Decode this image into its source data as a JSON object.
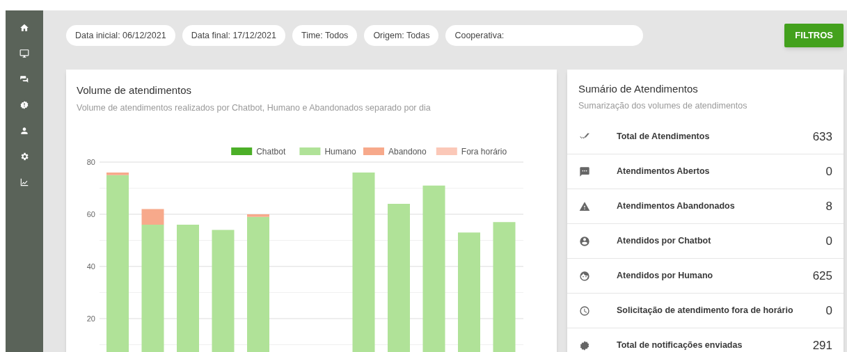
{
  "filters": [
    {
      "kind": "chip",
      "label": "Data inicial: 06/12/2021"
    },
    {
      "kind": "chip",
      "label": "Data final: 17/12/2021"
    },
    {
      "kind": "chip",
      "label": "Time: Todos"
    },
    {
      "kind": "chip",
      "label": "Origem: Todas"
    },
    {
      "kind": "field",
      "label": "Cooperativa:"
    }
  ],
  "filter_button": "FILTROS",
  "volume_card": {
    "title": "Volume de atendimentos",
    "subtitle": "Volume de atendimentos realizados por Chatbot, Humano e Abandonados separado por dia",
    "chart_data": {
      "type": "bar",
      "stacked": true,
      "grid": true,
      "legend": true,
      "ylim": [
        0,
        80
      ],
      "yticks": [
        20,
        40,
        60,
        80
      ],
      "series": [
        {
          "name": "Chatbot",
          "color": "#4caf28",
          "values": [
            0,
            0,
            0,
            0,
            0,
            0,
            0,
            0,
            0,
            0,
            0,
            0
          ]
        },
        {
          "name": "Humano",
          "color": "#b0e298",
          "values": [
            75,
            56,
            56,
            54,
            59,
            0,
            0,
            76,
            64,
            71,
            53,
            57
          ]
        },
        {
          "name": "Abandono",
          "color": "#f7a98b",
          "values": [
            1,
            6,
            0,
            0,
            1,
            0,
            0,
            0,
            0,
            0,
            0,
            0
          ]
        },
        {
          "name": "Fora horário",
          "color": "#fbc8b8",
          "values": [
            0,
            0,
            0,
            0,
            0,
            0,
            0,
            0,
            0,
            0,
            0,
            0
          ]
        }
      ]
    }
  },
  "summary_card": {
    "title": "Sumário de Atendimentos",
    "subtitle": "Sumarização dos volumes de atendimentos",
    "rows": [
      {
        "kind": "total",
        "label": "Total de Atendimentos",
        "value": "633"
      },
      {
        "kind": "open",
        "label": "Atendimentos Abertos",
        "value": "0"
      },
      {
        "kind": "abandoned",
        "label": "Atendimentos Abandonados",
        "value": "8"
      },
      {
        "kind": "chatbot",
        "label": "Atendidos por Chatbot",
        "value": "0"
      },
      {
        "kind": "human",
        "label": "Atendidos por Humano",
        "value": "625"
      },
      {
        "kind": "after_hours",
        "label": "Solicitação de atendimento fora de horário",
        "value": "0"
      },
      {
        "kind": "notifications",
        "label": "Total de notificações enviadas",
        "value": "291"
      }
    ]
  }
}
